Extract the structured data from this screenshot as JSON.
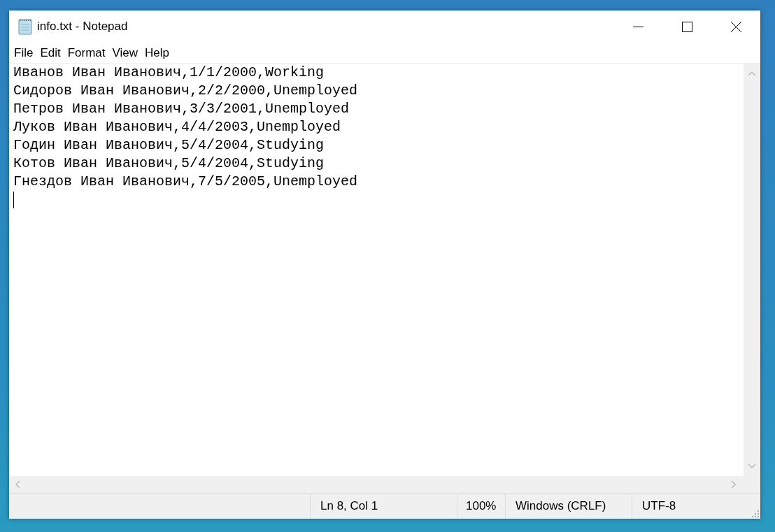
{
  "window": {
    "title": "info.txt - Notepad"
  },
  "menu": [
    "File",
    "Edit",
    "Format",
    "View",
    "Help"
  ],
  "editor": {
    "lines": [
      "Иванов Иван Иванович,1/1/2000,Working",
      "Сидоров Иван Иванович,2/2/2000,Unemployed",
      "Петров Иван Иванович,3/3/2001,Unemployed",
      "Луков Иван Иванович,4/4/2003,Unemployed",
      "Годин Иван Иванович,5/4/2004,Studying",
      "Котов Иван Иванович,5/4/2004,Studying",
      "Гнездов Иван Иванович,7/5/2005,Unemployed"
    ]
  },
  "status_bar": {
    "position": "Ln 8, Col 1",
    "zoom": "100%",
    "line_ending": "Windows (CRLF)",
    "encoding": "UTF-8"
  }
}
